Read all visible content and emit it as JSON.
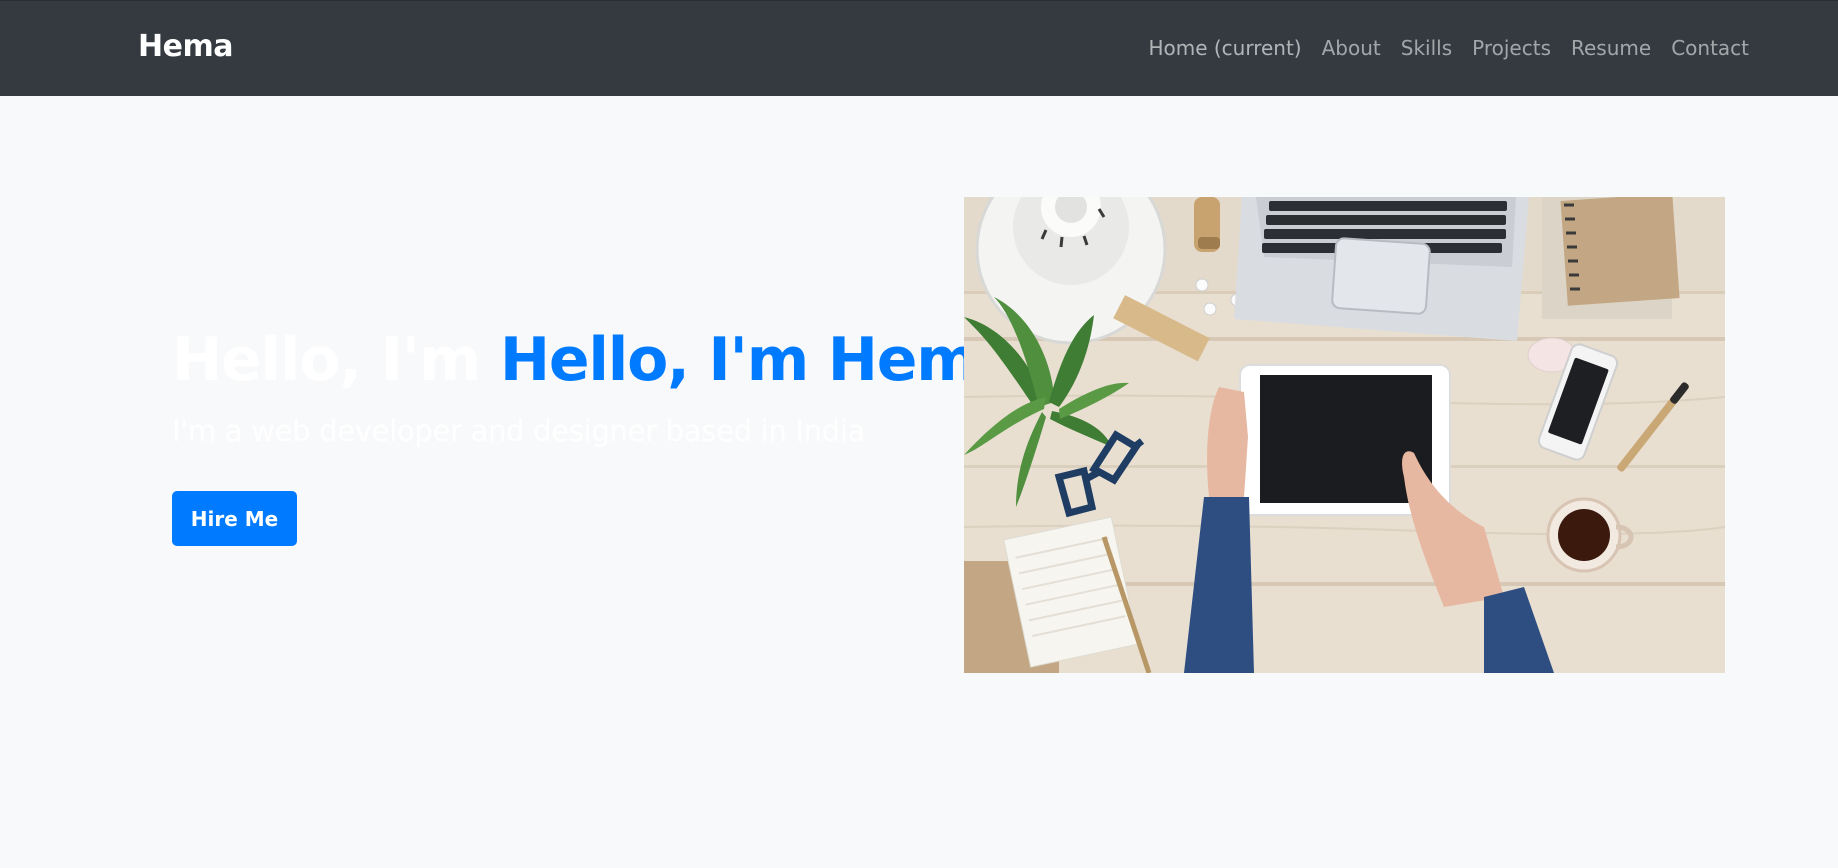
{
  "navbar": {
    "brand": "Hema",
    "links": [
      {
        "label": "Home (current)",
        "active": true
      },
      {
        "label": "About"
      },
      {
        "label": "Skills"
      },
      {
        "label": "Projects"
      },
      {
        "label": "Resume"
      },
      {
        "label": "Contact"
      }
    ]
  },
  "hero": {
    "title_prefix": "Hello, I'm",
    "title_name": "Hello, I'm Hema",
    "subtitle": "I'm a web developer and designer based in India",
    "cta_label": "Hire Me",
    "image": "workspace-desk-photo"
  },
  "colors": {
    "navbar_bg": "#343a40",
    "page_bg": "#f8f9fa",
    "accent": "#007bff"
  }
}
